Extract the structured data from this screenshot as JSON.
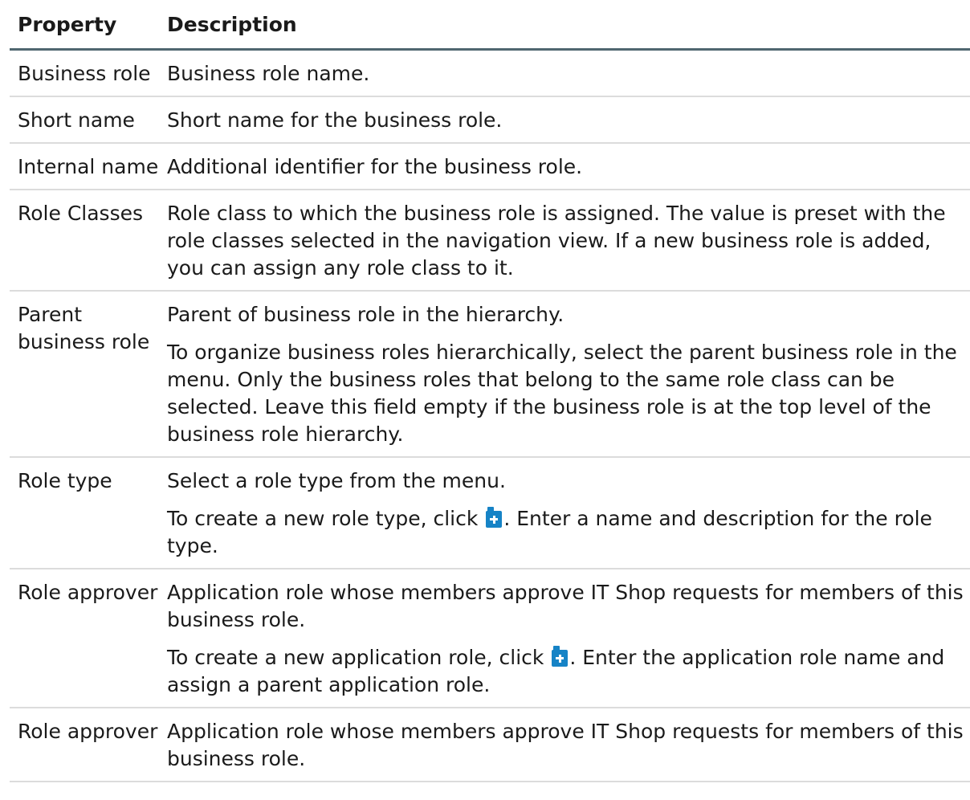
{
  "table": {
    "headers": {
      "property": "Property",
      "description": "Description"
    },
    "rows": [
      {
        "property": "Business role",
        "paragraphs": [
          [
            "Business role name."
          ]
        ]
      },
      {
        "property": "Short name",
        "paragraphs": [
          [
            "Short name for the business role."
          ]
        ]
      },
      {
        "property": "Internal name",
        "paragraphs": [
          [
            "Additional identifier for the business role."
          ]
        ]
      },
      {
        "property": "Role Classes",
        "paragraphs": [
          [
            "Role class to which the business role is assigned. The value is preset with the role classes selected in the navigation view. If a new business role is added, you can assign any role class to it."
          ]
        ]
      },
      {
        "property": "Parent business role",
        "paragraphs": [
          [
            "Parent of business role in the hierarchy."
          ],
          [
            "To organize business roles hierarchically, select the parent business role in the menu. Only the business roles that belong to the same role class can be selected. Leave this field empty if the business role is at the top level of the business role hierarchy."
          ]
        ]
      },
      {
        "property": "Role type",
        "paragraphs": [
          [
            "Select a role type from the menu."
          ],
          [
            "To create a new role type, click ",
            "ICON",
            ". Enter a name and description for the role type."
          ]
        ]
      },
      {
        "property": "Role approver",
        "paragraphs": [
          [
            "Application role whose members approve IT Shop requests for members of this business role."
          ],
          [
            "To create a new application role, click ",
            "ICON",
            ". Enter the application role name and assign a parent application role."
          ]
        ]
      },
      {
        "property": "Role approver",
        "paragraphs": [
          [
            "Application role whose members approve IT Shop requests for members of this business role."
          ]
        ]
      }
    ]
  },
  "icons": {
    "inline_add": "add-document-icon"
  },
  "colors": {
    "icon": "#1683c6",
    "header_rule": "#4f6670",
    "row_rule": "#dcdcdc"
  }
}
